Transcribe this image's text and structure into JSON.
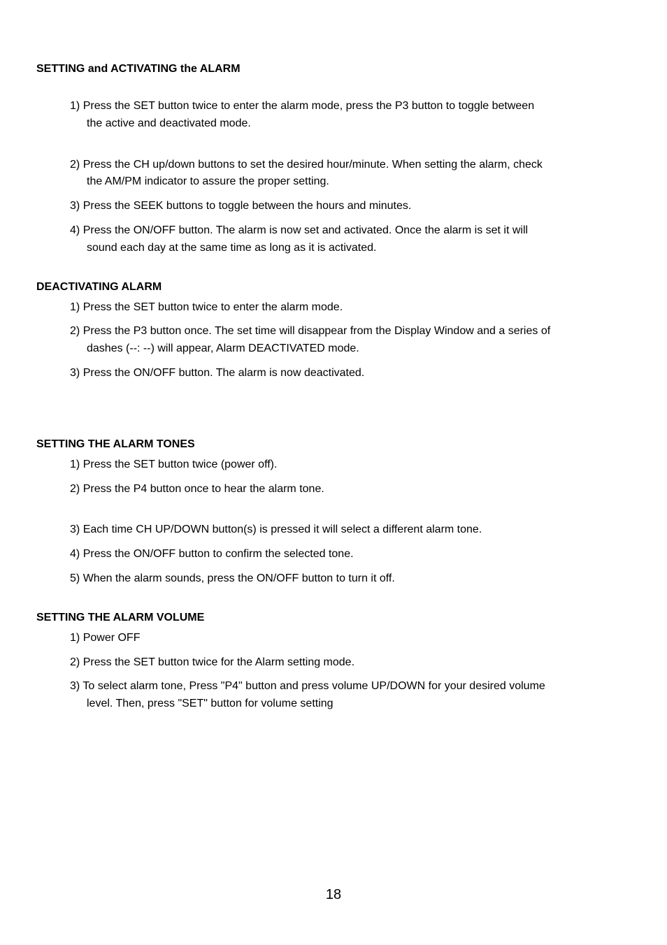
{
  "section1": {
    "title": "SETTING and ACTIVATING the ALARM",
    "items": [
      {
        "num": "1)",
        "text": "Press the SET button twice to enter the alarm mode, press the P3 button to toggle between",
        "cont": "the active and deactivated mode."
      },
      {
        "num": "2)",
        "text": "Press the CH up/down buttons to set the desired hour/minute. When setting the alarm, check",
        "cont": "the AM/PM indicator to assure the proper setting."
      },
      {
        "num": "3)",
        "text": "Press the SEEK buttons to toggle between the hours and minutes."
      },
      {
        "num": "4)",
        "text": "Press the ON/OFF button. The alarm is now set and activated.  Once the alarm is set it will",
        "cont": "sound each day at the same time as long as it is activated."
      }
    ]
  },
  "section2": {
    "title": "DEACTIVATING ALARM",
    "items": [
      {
        "num": "1)",
        "text": "Press the SET button twice to enter the alarm mode."
      },
      {
        "num": "2)",
        "text": "Press the P3 button once. The set time will disappear from the Display Window and a series of",
        "cont": "dashes (--: --) will appear, Alarm DEACTIVATED mode."
      },
      {
        "num": "3)",
        "text": "Press the ON/OFF button. The alarm is now deactivated."
      }
    ]
  },
  "section3": {
    "title": "SETTING THE ALARM TONES",
    "items": [
      {
        "num": "1)",
        "text": "Press the SET button twice (power off)."
      },
      {
        "num": "2)",
        "text": "Press the P4 button once to hear the alarm tone."
      },
      {
        "num": "3)",
        "text": "Each time CH UP/DOWN button(s) is pressed it will select a different alarm tone."
      },
      {
        "num": "4)",
        "text": "Press the ON/OFF button to confirm the selected tone."
      },
      {
        "num": "5)",
        "text": "When the alarm sounds, press the ON/OFF button to turn it off."
      }
    ]
  },
  "section4": {
    "title": "SETTING THE ALARM VOLUME",
    "items": [
      {
        "num": "1)",
        "text": "Power OFF"
      },
      {
        "num": "2)",
        "text": "Press the SET button twice for the Alarm setting mode."
      },
      {
        "num": "3)",
        "text": "To select alarm tone, Press \"P4\" button and press volume UP/DOWN for your desired volume",
        "cont": "level.   Then, press \"SET\" button for volume setting"
      }
    ]
  },
  "pageNumber": "18"
}
